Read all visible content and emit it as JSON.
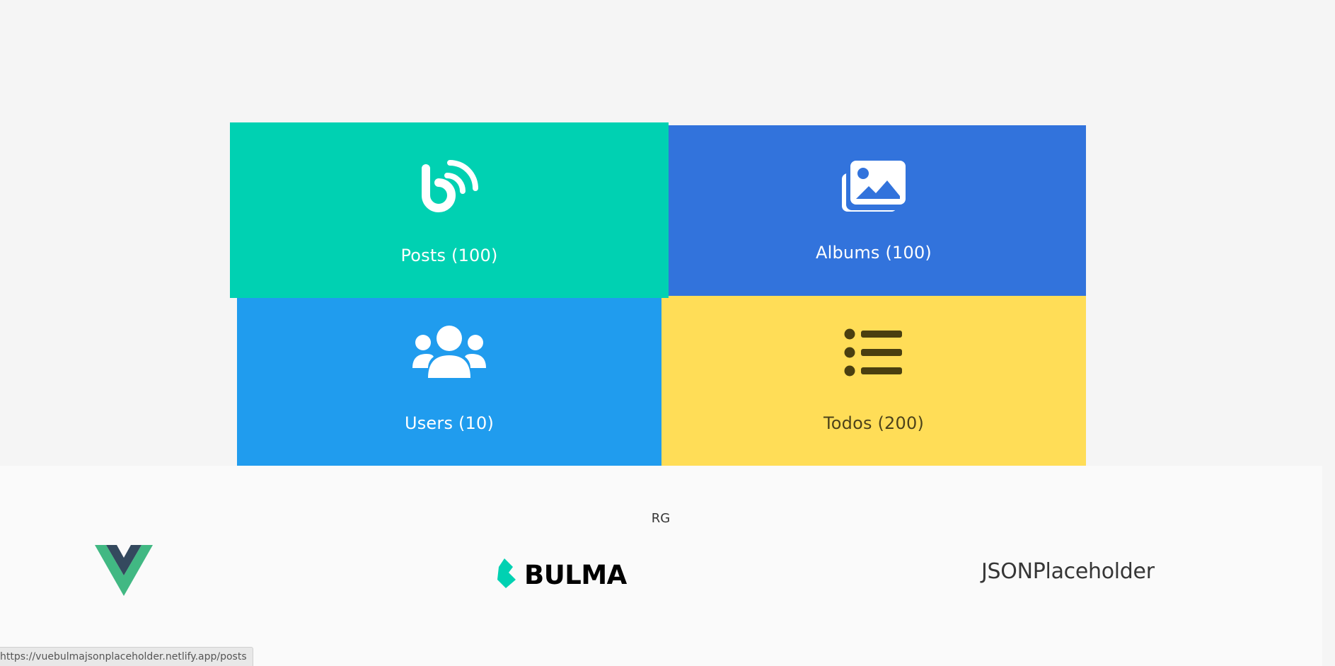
{
  "tiles": [
    {
      "key": "posts",
      "label": "Posts (100)",
      "icon": "rss-blog-icon",
      "color": "#00d1b2"
    },
    {
      "key": "albums",
      "label": "Albums (100)",
      "icon": "images-icon",
      "color": "#3273dc"
    },
    {
      "key": "users",
      "label": "Users (10)",
      "icon": "users-icon",
      "color": "#209cee"
    },
    {
      "key": "todos",
      "label": "Todos (200)",
      "icon": "list-icon",
      "color": "#ffdd57"
    }
  ],
  "footer": {
    "credit": "RG",
    "logos": {
      "vue": "vue-logo",
      "bulma": "BULMA",
      "jsonplaceholder": "JSONPlaceholder"
    }
  },
  "status_bar": {
    "url": "https://vuebulmajsonplaceholder.netlify.app/posts"
  },
  "colors": {
    "background": "#f5f5f5",
    "footer_bg": "#fafafa",
    "vue_green": "#41b883",
    "vue_dark": "#34495e",
    "bulma_teal": "#00d1b2"
  }
}
